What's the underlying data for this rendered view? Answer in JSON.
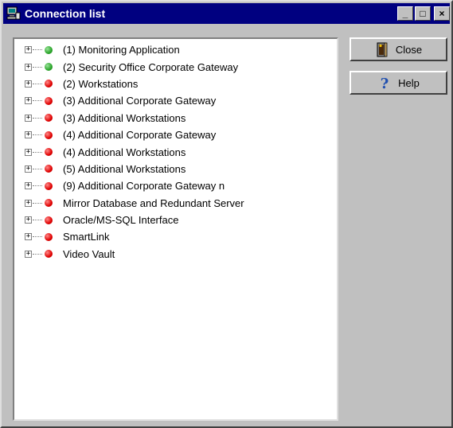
{
  "window": {
    "title": "Connection list",
    "buttons": {
      "minimize": "_",
      "maximize": "□",
      "close": "×"
    }
  },
  "tree": {
    "items": [
      {
        "label": "(1) Monitoring Application",
        "status": "green"
      },
      {
        "label": "(2) Security Office Corporate Gateway",
        "status": "green"
      },
      {
        "label": "(2) Workstations",
        "status": "red"
      },
      {
        "label": "(3) Additional Corporate Gateway",
        "status": "red"
      },
      {
        "label": "(3) Additional Workstations",
        "status": "red"
      },
      {
        "label": "(4) Additional Corporate Gateway",
        "status": "red"
      },
      {
        "label": "(4) Additional Workstations",
        "status": "red"
      },
      {
        "label": "(5) Additional Workstations",
        "status": "red"
      },
      {
        "label": "(9) Additional Corporate Gateway n",
        "status": "red"
      },
      {
        "label": "Mirror Database and Redundant Server",
        "status": "red"
      },
      {
        "label": "Oracle/MS-SQL Interface",
        "status": "red"
      },
      {
        "label": "SmartLink",
        "status": "red"
      },
      {
        "label": "Video Vault",
        "status": "red"
      }
    ]
  },
  "actions": {
    "close_label": "Close",
    "help_label": "Help"
  },
  "icons": {
    "app": "network-computer-icon",
    "close": "door-exit-icon",
    "help": "question-mark-icon"
  },
  "colors": {
    "titlebar": "#000080",
    "status_green": "#2aa52a",
    "status_red": "#e00000",
    "help_icon": "#1f4fb0"
  }
}
